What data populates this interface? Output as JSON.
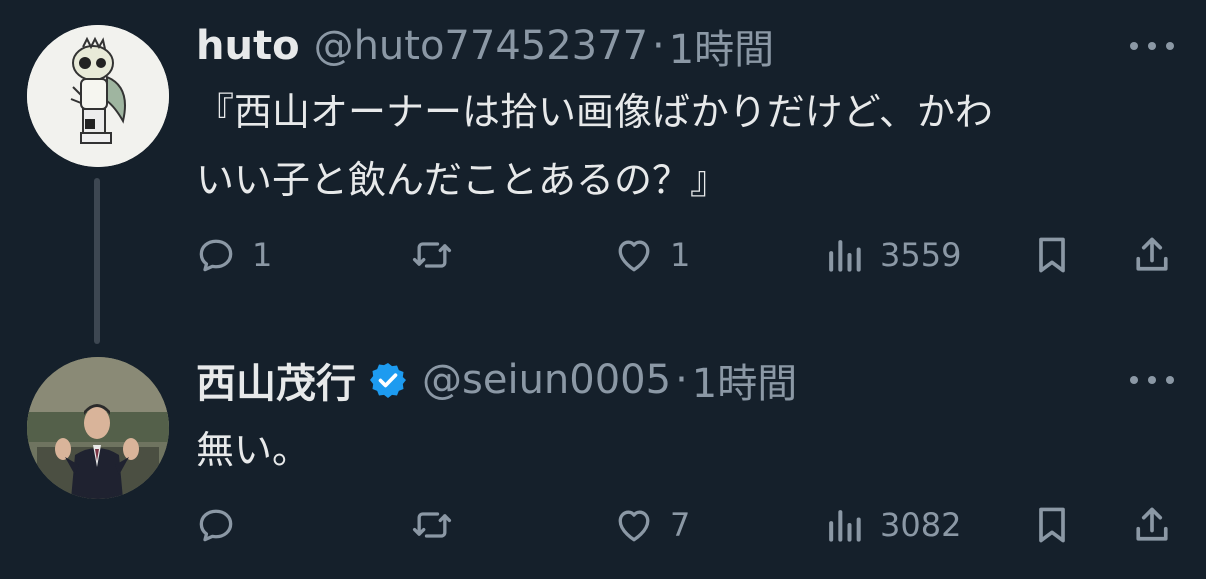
{
  "tweets": [
    {
      "name": "huto",
      "handle": "@huto77452377",
      "separator": "·",
      "time": "1時間",
      "text_lines": [
        "『西山オーナーは拾い画像ばかりだけど、かわ",
        "いい子と飲んだことあるの？』"
      ],
      "replies": "1",
      "retweets": "",
      "likes": "1",
      "views": "3559",
      "verified": false
    },
    {
      "name": "西山茂行",
      "handle": "@seiun0005",
      "separator": "·",
      "time": "1時間",
      "text_lines": [
        "無い。"
      ],
      "replies": "",
      "retweets": "",
      "likes": "7",
      "views": "3082",
      "verified": true
    }
  ],
  "colors": {
    "background": "#15202b",
    "text_primary": "#e7e9ea",
    "text_secondary": "#8b98a5",
    "verified": "#1d9bf0"
  },
  "icons": [
    "reply-icon",
    "retweet-icon",
    "like-icon",
    "views-icon",
    "bookmark-icon",
    "share-icon",
    "more-icon",
    "verified-badge-icon"
  ]
}
